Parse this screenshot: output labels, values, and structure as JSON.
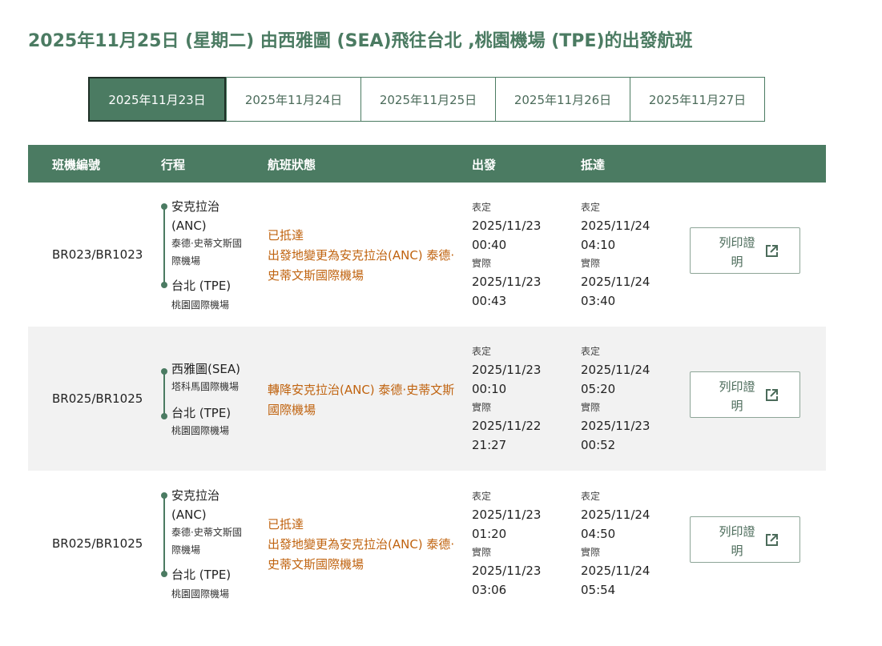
{
  "page_title": "2025年11月25日 (星期二) 由西雅圖 (SEA)飛往台北 ,桃園機場 (TPE)的出發航班",
  "date_tabs": [
    {
      "label": "2025年11月23日",
      "active": true
    },
    {
      "label": "2025年11月24日",
      "active": false
    },
    {
      "label": "2025年11月25日",
      "active": false
    },
    {
      "label": "2025年11月26日",
      "active": false
    },
    {
      "label": "2025年11月27日",
      "active": false
    }
  ],
  "table": {
    "headers": {
      "flight_no": "班機編號",
      "route": "行程",
      "status": "航班狀態",
      "departure": "出發",
      "arrival": "抵達"
    },
    "scheduled_label": "表定",
    "actual_label": "實際",
    "print_label": "列印證明",
    "rows": [
      {
        "flight_no": "BR023/BR1023",
        "from_city": "安克拉治(ANC)",
        "from_airport": "泰德·史蒂文斯國際機場",
        "to_city": "台北 (TPE)",
        "to_airport": "桃園國際機場",
        "status_line1": "已抵達",
        "status_line2": "出發地變更為安克拉治(ANC) 泰德·史蒂文斯國際機場",
        "dep_scheduled_date": "2025/11/23",
        "dep_scheduled_time": "00:40",
        "dep_actual_date": "2025/11/23",
        "dep_actual_time": "00:43",
        "arr_scheduled_date": "2025/11/24",
        "arr_scheduled_time": "04:10",
        "arr_actual_date": "2025/11/24",
        "arr_actual_time": "03:40"
      },
      {
        "flight_no": "BR025/BR1025",
        "from_city": "西雅圖(SEA)",
        "from_airport": "塔科馬國際機場",
        "to_city": "台北 (TPE)",
        "to_airport": "桃園國際機場",
        "status_line1": "轉降安克拉治(ANC) 泰德·史蒂文斯國際機場",
        "status_line2": "",
        "dep_scheduled_date": "2025/11/23",
        "dep_scheduled_time": "00:10",
        "dep_actual_date": "2025/11/22",
        "dep_actual_time": "21:27",
        "arr_scheduled_date": "2025/11/24",
        "arr_scheduled_time": "05:20",
        "arr_actual_date": "2025/11/23",
        "arr_actual_time": "00:52"
      },
      {
        "flight_no": "BR025/BR1025",
        "from_city": "安克拉治(ANC)",
        "from_airport": "泰德·史蒂文斯國際機場",
        "to_city": "台北 (TPE)",
        "to_airport": "桃園國際機場",
        "status_line1": "已抵達",
        "status_line2": "出發地變更為安克拉治(ANC) 泰德·史蒂文斯國際機場",
        "dep_scheduled_date": "2025/11/23",
        "dep_scheduled_time": "01:20",
        "dep_actual_date": "2025/11/23",
        "dep_actual_time": "03:06",
        "arr_scheduled_date": "2025/11/24",
        "arr_scheduled_time": "04:50",
        "arr_actual_date": "2025/11/24",
        "arr_actual_time": "05:54"
      }
    ]
  },
  "colors": {
    "brand_green": "#4b7b62",
    "status_orange": "#c0630f",
    "alt_row": "#f2f2f2"
  },
  "icons": {
    "print_button_icon": "external-link-icon"
  }
}
